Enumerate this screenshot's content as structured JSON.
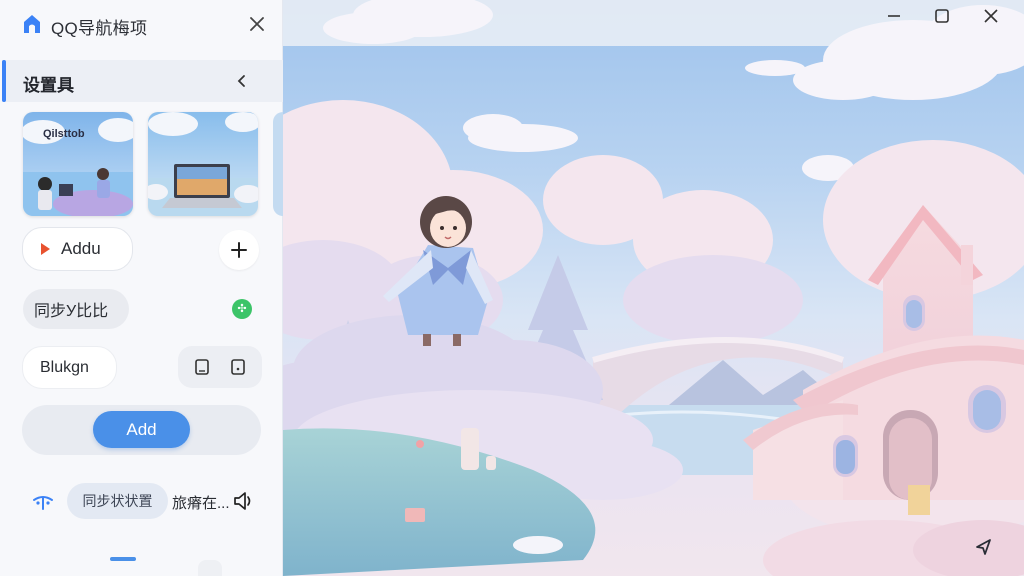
{
  "app": {
    "title": "QQ导航梅项"
  },
  "section": {
    "title": "设置具"
  },
  "thumbnails": [
    {
      "caption": "Qilsttob"
    },
    {
      "caption": ""
    }
  ],
  "buttons": {
    "addu_label": "Addu",
    "sync_label": "同步У比比",
    "blukgn_label": "Blukgn",
    "add_label": "Add"
  },
  "bottom": {
    "sync_chip": "同步状状置",
    "status": "旅瘠在..."
  },
  "colors": {
    "accent": "#4a90e8",
    "green": "#3cc468",
    "red": "#e8522f"
  },
  "icons": [
    "app-house-icon",
    "close-icon",
    "chevron-left-icon",
    "play-icon",
    "plus-icon",
    "status-dot-icon",
    "tablet-icon",
    "square-icon",
    "share-icon",
    "speaker-icon",
    "minimize-icon",
    "maximize-icon",
    "window-close-icon",
    "cursor-arrow-icon"
  ]
}
